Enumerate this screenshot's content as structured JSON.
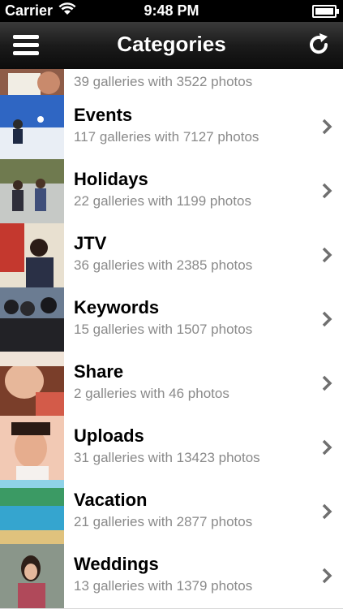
{
  "status": {
    "carrier": "Carrier",
    "time": "9:48 PM"
  },
  "nav": {
    "title": "Categories"
  },
  "categories": [
    {
      "title": "",
      "subtitle": "39 galleries with 3522 photos",
      "thumb_color": "#c48a6a"
    },
    {
      "title": "Events",
      "subtitle": "117 galleries with 7127 photos",
      "thumb_color": "#3f73c8"
    },
    {
      "title": "Holidays",
      "subtitle": "22 galleries with 1199 photos",
      "thumb_color": "#9aa4a6"
    },
    {
      "title": "JTV",
      "subtitle": "36 galleries with 2385 photos",
      "thumb_color": "#b8473c"
    },
    {
      "title": "Keywords",
      "subtitle": "15 galleries with 1507 photos",
      "thumb_color": "#4b5b74"
    },
    {
      "title": "Share",
      "subtitle": "2 galleries with 46 photos",
      "thumb_color": "#c98c6e"
    },
    {
      "title": "Uploads",
      "subtitle": "31 galleries with 13423 photos",
      "thumb_color": "#d3a68a"
    },
    {
      "title": "Vacation",
      "subtitle": "21 galleries with 2877 photos",
      "thumb_color": "#4fa6c8"
    },
    {
      "title": "Weddings",
      "subtitle": "13 galleries with 1379 photos",
      "thumb_color": "#6f7d6a"
    }
  ]
}
